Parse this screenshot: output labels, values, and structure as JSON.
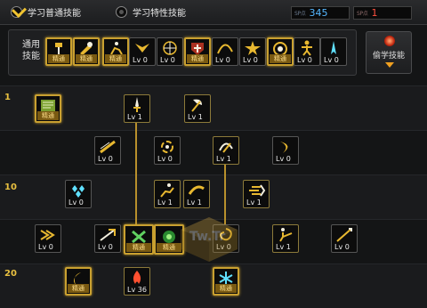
{
  "tabs": {
    "normal_label": "学习普通技能",
    "special_label": "学习特性技能"
  },
  "sp": {
    "blue_tag": "SP点",
    "blue_value": "345",
    "red_tag": "SP点",
    "red_value": "1"
  },
  "common": {
    "label_line1": "通用",
    "label_line2": "技能",
    "skills": [
      {
        "name": "skill-common-1",
        "icon": "hammer",
        "status": "精通"
      },
      {
        "name": "skill-common-2",
        "icon": "hammer-strike",
        "status": "精通"
      },
      {
        "name": "skill-common-3",
        "icon": "run",
        "status": "精通"
      },
      {
        "name": "skill-common-4",
        "icon": "wings",
        "status": "Lv 0"
      },
      {
        "name": "skill-common-5",
        "icon": "compass",
        "status": "Lv 0"
      },
      {
        "name": "skill-common-6",
        "icon": "shield-cross",
        "status": "精通"
      },
      {
        "name": "skill-common-7",
        "icon": "leap",
        "status": "Lv 0"
      },
      {
        "name": "skill-common-8",
        "icon": "burst",
        "status": "Lv 0"
      },
      {
        "name": "skill-common-9",
        "icon": "target",
        "status": "精通"
      },
      {
        "name": "skill-common-10",
        "icon": "figure",
        "status": "Lv 0"
      },
      {
        "name": "skill-common-11",
        "icon": "spike",
        "status": "Lv 0"
      }
    ],
    "steal_label": "偷学技能"
  },
  "tree": {
    "levels": [
      "1",
      "10",
      "20"
    ],
    "skills": {
      "s1": {
        "icon": "book",
        "status": "精通"
      },
      "s2": {
        "icon": "dagger",
        "status": "Lv 1"
      },
      "s3": {
        "icon": "axe",
        "status": "Lv 1"
      },
      "s4": {
        "icon": "slash",
        "status": "Lv 0"
      },
      "s5": {
        "icon": "spin",
        "status": "Lv 0"
      },
      "s6": {
        "icon": "swing",
        "status": "Lv 1"
      },
      "s7": {
        "icon": "crescent",
        "status": "Lv 0"
      },
      "s8": {
        "icon": "crystals",
        "status": "Lv 0"
      },
      "s9": {
        "icon": "runner",
        "status": "Lv 1"
      },
      "s10": {
        "icon": "arc",
        "status": "Lv 1"
      },
      "s11": {
        "icon": "dash",
        "status": "Lv 1"
      },
      "s12": {
        "icon": "sweep",
        "status": "Lv 0"
      },
      "s13": {
        "icon": "thrust",
        "status": "Lv 0"
      },
      "s14": {
        "icon": "cross",
        "status": "精通"
      },
      "s15": {
        "icon": "orb",
        "status": "精通"
      },
      "s16": {
        "icon": "whirl",
        "status": "Lv 0"
      },
      "s17": {
        "icon": "kick",
        "status": "Lv 1"
      },
      "s18": {
        "icon": "lance",
        "status": "Lv 0"
      },
      "s19": {
        "icon": "moon",
        "status": "精通"
      },
      "s20": {
        "icon": "flame",
        "status": "Lv 36"
      },
      "s21": {
        "icon": "frost",
        "status": "精通"
      }
    }
  },
  "watermark_text": "Tw.Tr"
}
